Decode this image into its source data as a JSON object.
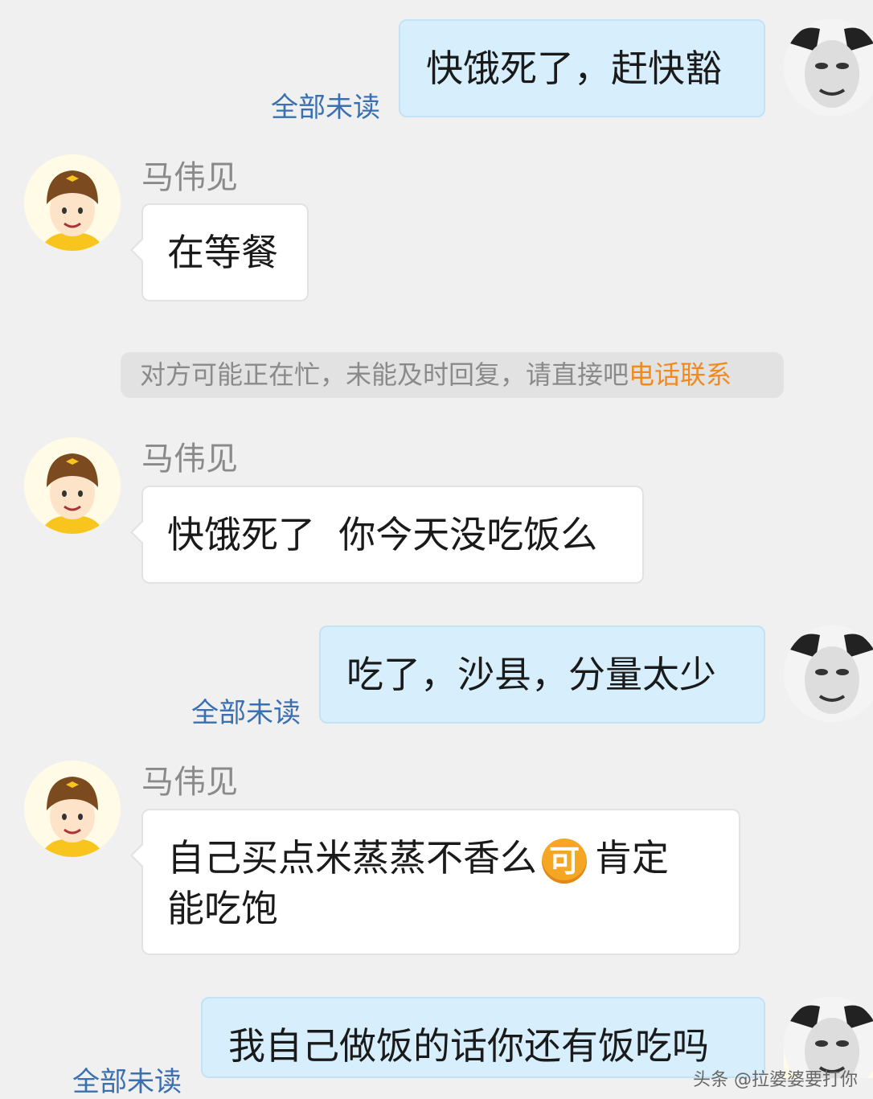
{
  "contact_name": "马伟见",
  "read_status": "全部未读",
  "messages": [
    {
      "side": "out",
      "text": "快饿死了，赶快豁"
    },
    {
      "side": "in",
      "text": "在等餐"
    },
    {
      "side": "in",
      "text": "快饿死了  你今天没吃饭么"
    },
    {
      "side": "out",
      "text": "吃了，沙县，分量太少"
    },
    {
      "side": "in",
      "text_before": "自己买点米蒸蒸不香么",
      "emoji_char": "可",
      "text_after": "肯定",
      "text_line2": "能吃饱"
    },
    {
      "side": "out",
      "text": "我自己做饭的话你还有饭吃吗"
    }
  ],
  "notice": {
    "text": "对方可能正在忙，未能及时回复，请直接吧",
    "link": "电话联系"
  },
  "icons": {
    "self_avatar": "meme-face-avatar",
    "courier_avatar": "courier-helmet-avatar",
    "emoji": "ke-emoji-icon"
  },
  "colors": {
    "outgoing_bubble": "#d7effd",
    "incoming_bubble": "#ffffff",
    "status_blue": "#3a6fb0",
    "notice_link": "#f08a1c"
  },
  "watermark": "头条 @拉婆婆要打你"
}
